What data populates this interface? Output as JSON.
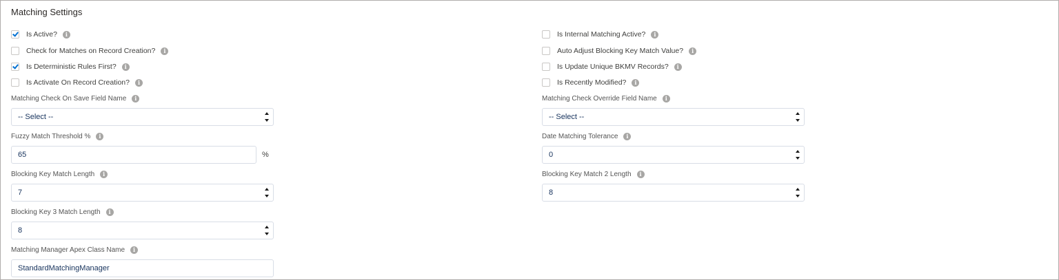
{
  "section": {
    "title": "Matching Settings"
  },
  "left_checkboxes": [
    {
      "label": "Is Active?",
      "checked": true
    },
    {
      "label": "Check for Matches on Record Creation?",
      "checked": false
    },
    {
      "label": "Is Deterministic Rules First?",
      "checked": true
    },
    {
      "label": "Is Activate On Record Creation?",
      "checked": false
    }
  ],
  "right_checkboxes": [
    {
      "label": "Is Internal Matching Active?",
      "checked": false
    },
    {
      "label": "Auto Adjust Blocking Key Match Value?",
      "checked": false
    },
    {
      "label": "Is Update Unique BKMV Records?",
      "checked": false
    },
    {
      "label": "Is Recently Modified?",
      "checked": false
    }
  ],
  "fields": {
    "matching_check_on_save": {
      "label": "Matching Check On Save Field Name",
      "value": "-- Select --"
    },
    "matching_check_override": {
      "label": "Matching Check Override Field Name",
      "value": "-- Select --"
    },
    "fuzzy_match_threshold": {
      "label": "Fuzzy Match Threshold %",
      "value": "65",
      "suffix": "%"
    },
    "date_matching_tolerance": {
      "label": "Date Matching Tolerance",
      "value": "0"
    },
    "blocking_key_match_length": {
      "label": "Blocking Key Match Length",
      "value": "7"
    },
    "blocking_key_match_2_length": {
      "label": "Blocking Key Match 2 Length",
      "value": "8"
    },
    "blocking_key_3_match_length": {
      "label": "Blocking Key 3 Match Length",
      "value": "8"
    },
    "matching_manager_apex_class": {
      "label": "Matching Manager Apex Class Name",
      "value": "StandardMatchingManager"
    }
  },
  "icons": {
    "info": "i"
  },
  "colors": {
    "checkbox_check": "#0070d2",
    "info_icon": "#a8a7a5",
    "field_border": "#d8dde6"
  }
}
